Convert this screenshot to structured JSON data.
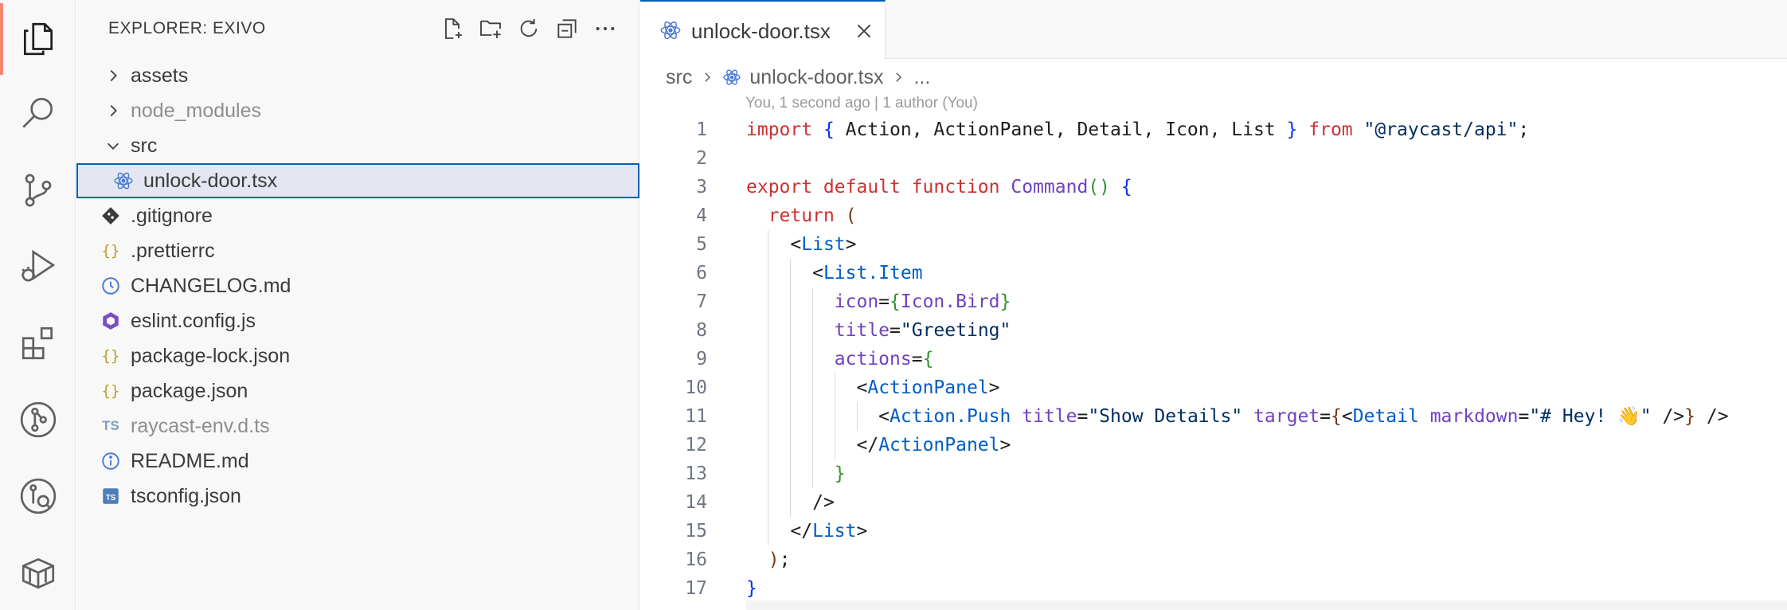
{
  "activity_bar": {
    "items": [
      {
        "name": "explorer",
        "icon": "files-icon",
        "active": true
      },
      {
        "name": "search",
        "icon": "search-icon"
      },
      {
        "name": "source-control",
        "icon": "source-control-icon"
      },
      {
        "name": "run-debug",
        "icon": "run-debug-icon"
      },
      {
        "name": "extensions",
        "icon": "extensions-icon"
      },
      {
        "name": "git-graph",
        "icon": "git-graph-icon"
      },
      {
        "name": "git-lens",
        "icon": "gitlens-icon"
      },
      {
        "name": "containers",
        "icon": "package-icon"
      }
    ],
    "accent_color": "#f48771"
  },
  "sidebar": {
    "title": "EXPLORER: EXIVO",
    "actions": [
      "new-file-icon",
      "new-folder-icon",
      "refresh-icon",
      "collapse-all-icon",
      "more-icon"
    ],
    "tree": [
      {
        "label": "assets",
        "kind": "folder",
        "expanded": false,
        "depth": 0
      },
      {
        "label": "node_modules",
        "kind": "folder",
        "expanded": false,
        "depth": 0,
        "dim": true
      },
      {
        "label": "src",
        "kind": "folder",
        "expanded": true,
        "depth": 0
      },
      {
        "label": "unlock-door.tsx",
        "kind": "react",
        "depth": 1,
        "selected": true
      },
      {
        "label": ".gitignore",
        "kind": "git",
        "depth": 0
      },
      {
        "label": ".prettierrc",
        "kind": "json",
        "depth": 0
      },
      {
        "label": "CHANGELOG.md",
        "kind": "changelog",
        "depth": 0
      },
      {
        "label": "eslint.config.js",
        "kind": "eslint",
        "depth": 0
      },
      {
        "label": "package-lock.json",
        "kind": "json",
        "depth": 0
      },
      {
        "label": "package.json",
        "kind": "json",
        "depth": 0
      },
      {
        "label": "raycast-env.d.ts",
        "kind": "ts",
        "depth": 0,
        "dim": true
      },
      {
        "label": "README.md",
        "kind": "info",
        "depth": 0
      },
      {
        "label": "tsconfig.json",
        "kind": "tsconfig",
        "depth": 0
      }
    ]
  },
  "editor": {
    "tab": {
      "label": "unlock-door.tsx",
      "icon": "react-icon",
      "close_icon": "close-icon"
    },
    "breadcrumb": [
      "src",
      "unlock-door.tsx",
      "..."
    ],
    "blame": "You, 1 second ago | 1 author (You)",
    "line_numbers": [
      "1",
      "2",
      "3",
      "4",
      "5",
      "6",
      "7",
      "8",
      "9",
      "10",
      "11",
      "12",
      "13",
      "14",
      "15",
      "16",
      "17"
    ],
    "code": {
      "l1": {
        "kw_import": "import",
        "open": "{",
        "names": " Action, ActionPanel, Detail, Icon, List ",
        "close": "}",
        "kw_from": "from",
        "str": "\"@raycast/api\"",
        "semi": ";"
      },
      "l3": {
        "kw": "export default function",
        "fn": "Command",
        "parens": "()",
        "brace": "{"
      },
      "l4": {
        "kw": "return",
        "paren": "("
      },
      "l5": {
        "lt": "<",
        "tag": "List",
        "gt": ">"
      },
      "l6": {
        "lt": "<",
        "tag": "List.Item"
      },
      "l7": {
        "attr": "icon",
        "eq": "=",
        "open": "{",
        "val": "Icon.Bird",
        "close": "}"
      },
      "l8": {
        "attr": "title",
        "eq": "=",
        "str": "\"Greeting\""
      },
      "l9": {
        "attr": "actions",
        "eq": "=",
        "open": "{"
      },
      "l10": {
        "lt": "<",
        "tag": "ActionPanel",
        "gt": ">"
      },
      "l11": {
        "lt": "<",
        "tag": "Action.Push",
        "attr1": "title",
        "eq1": "=",
        "str1": "\"Show Details\"",
        "attr2": "target",
        "eq2": "=",
        "open": "{",
        "lt2": "<",
        "tag2": "Detail",
        "attr3": "markdown",
        "eq3": "=",
        "str3": "\"# Hey! 👋\"",
        "selfclose": " />",
        "close": "}",
        "end": " />"
      },
      "l12": {
        "lt": "</",
        "tag": "ActionPanel",
        "gt": ">"
      },
      "l13": {
        "close": "}"
      },
      "l14": {
        "end": "/>"
      },
      "l15": {
        "lt": "</",
        "tag": "List",
        "gt": ">"
      },
      "l16": {
        "paren": ")",
        "semi": ";"
      },
      "l17": {
        "brace": "}"
      }
    }
  }
}
